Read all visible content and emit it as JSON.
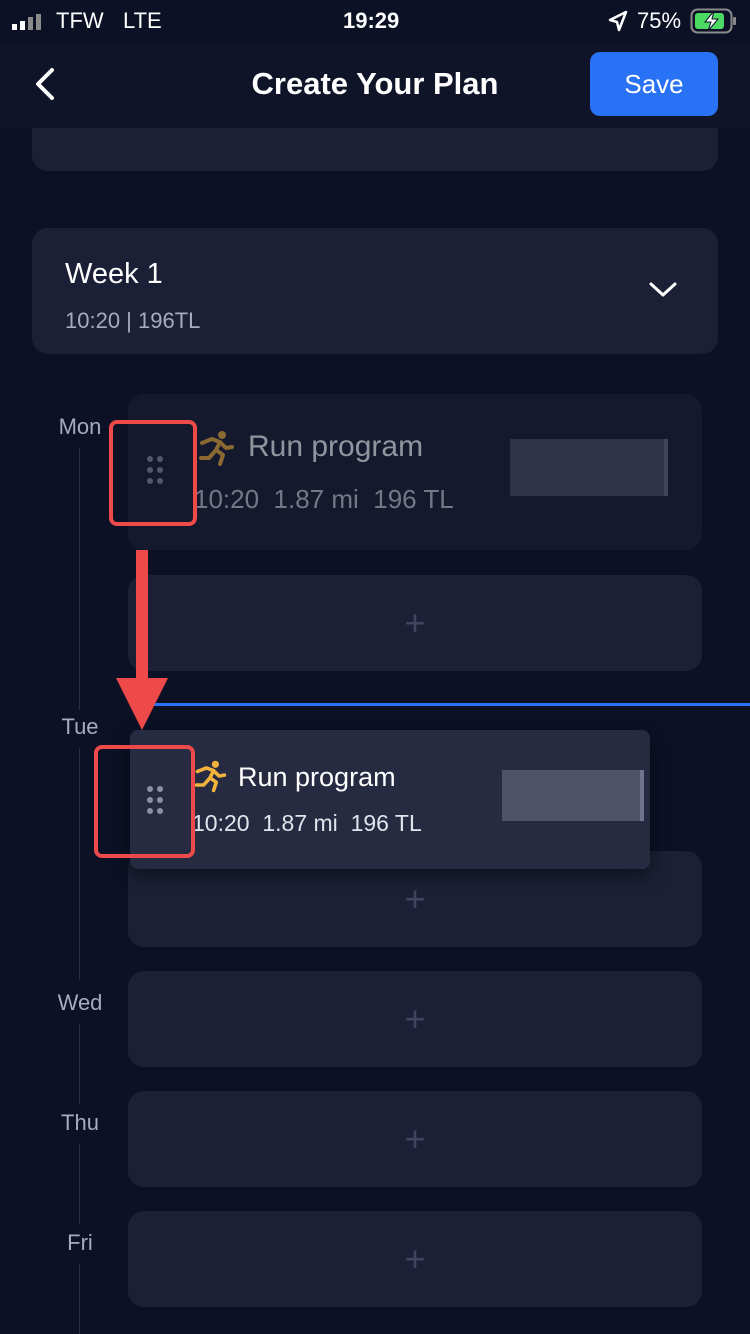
{
  "status_bar": {
    "carrier": "TFW",
    "network": "LTE",
    "time": "19:29",
    "battery": "75%"
  },
  "header": {
    "title": "Create Your Plan",
    "save_label": "Save"
  },
  "week": {
    "title": "Week 1",
    "summary": "10:20 | 196TL"
  },
  "days": {
    "mon": "Mon",
    "tue": "Tue",
    "wed": "Wed",
    "thu": "Thu",
    "fri": "Fri"
  },
  "workout": {
    "name": "Run program",
    "time": "10:20",
    "distance": "1.87 mi",
    "load": "196 TL"
  },
  "dragged_workout": {
    "name": "Run program",
    "time": "10:20",
    "distance": "1.87 mi",
    "load": "196 TL"
  },
  "add_symbol": "+",
  "colors": {
    "accent": "#2a72f5",
    "background": "#0c1126",
    "card": "#1b2036",
    "annotation": "#ef4a4a",
    "run_icon": "#f2b33d"
  }
}
